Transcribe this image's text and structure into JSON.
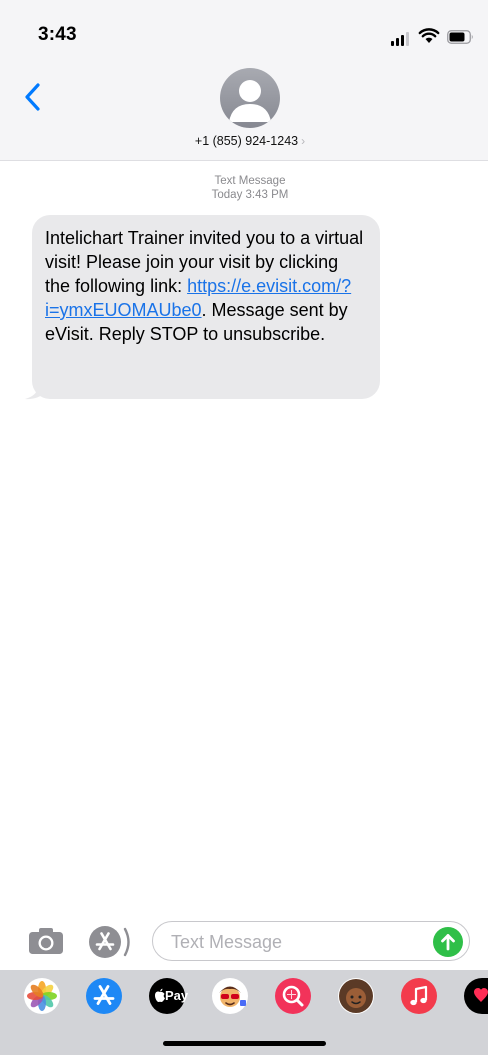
{
  "status_bar": {
    "time": "3:43",
    "signal_icon": "cellular-signal-icon",
    "wifi_icon": "wifi-icon",
    "battery_icon": "battery-icon"
  },
  "header": {
    "back_icon": "chevron-left-icon",
    "avatar_icon": "person-silhouette-icon",
    "contact_name": "+1 (855) 924-1243",
    "contact_chevron": "›"
  },
  "conversation": {
    "meta_line1": "Text Message",
    "meta_line2": "Today 3:43 PM",
    "message": {
      "text_before": "Intelichart Trainer invited you to a virtual visit! Please join your visit by clicking the following link: ",
      "link_text": "https://e.evisit.com/?i=ymxEUOMAUbe0",
      "text_after": ". Message sent by eVisit. Reply STOP to unsubscribe."
    }
  },
  "compose": {
    "camera_icon": "camera-icon",
    "apps_icon": "app-store-icon",
    "placeholder": "Text Message",
    "value": "",
    "send_icon": "arrow-up-icon"
  },
  "app_drawer": {
    "apps": [
      {
        "icon": "photos-icon"
      },
      {
        "icon": "app-store-icon"
      },
      {
        "icon": "apple-pay-icon",
        "label": "Pay"
      },
      {
        "icon": "memoji-stickers-icon"
      },
      {
        "icon": "images-search-icon"
      },
      {
        "icon": "memoji-icon"
      },
      {
        "icon": "music-icon"
      },
      {
        "icon": "digital-touch-icon"
      }
    ]
  },
  "colors": {
    "accent_blue": "#007aff",
    "link_blue": "#1a73e8",
    "bubble_gray": "#e9e9eb",
    "send_green": "#2fbf48"
  }
}
